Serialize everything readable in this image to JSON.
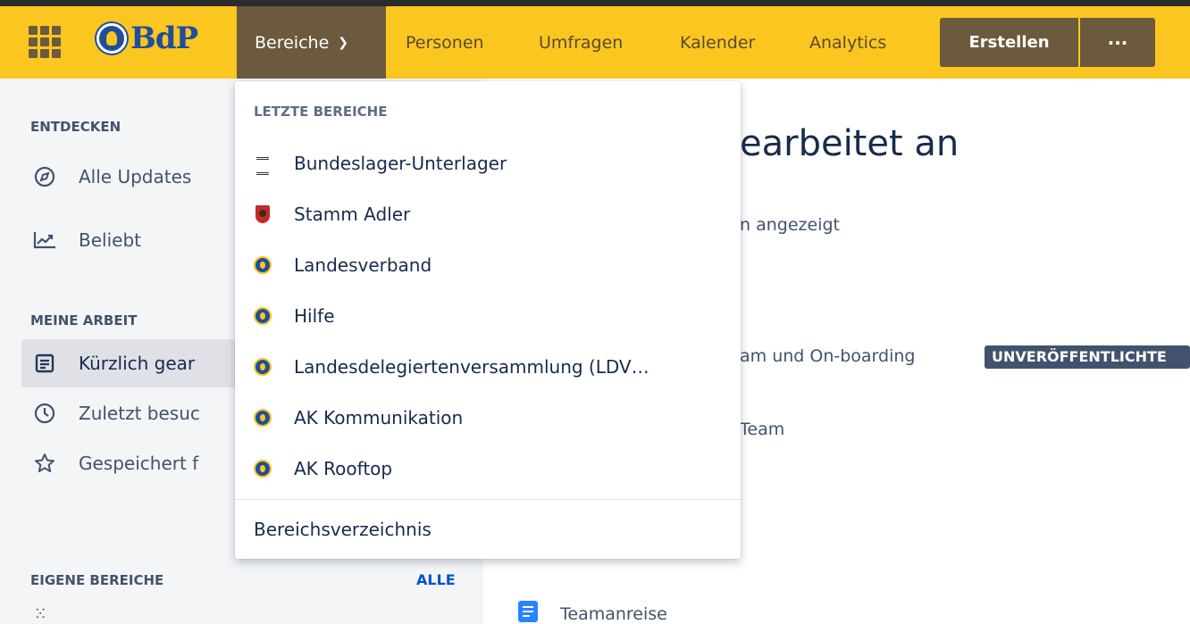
{
  "header": {
    "logo_text": "BdP",
    "nav_active": "Bereiche",
    "nav": [
      "Personen",
      "Umfragen",
      "Kalender",
      "Analytics"
    ],
    "create_label": "Erstellen",
    "more_label": "···"
  },
  "sidebar": {
    "discover_title": "ENTDECKEN",
    "discover_items": [
      "Alle Updates",
      "Beliebt"
    ],
    "mywork_title": "MEINE ARBEIT",
    "mywork_items": [
      "Kürzlich gear",
      "Zuletzt besuc",
      "Gespeichert f"
    ],
    "own_spaces_title": "EIGENE BEREICHE",
    "own_spaces_all": "ALLE"
  },
  "main": {
    "title": "earbeitet an",
    "subtitle": "n angezeigt",
    "item1": "am und On-boarding",
    "badge": "UNVERÖFFENTLICHTE",
    "item2": "Team",
    "item3": "Teamanreise"
  },
  "dropdown": {
    "heading": "LETZTE BEREICHE",
    "items": [
      {
        "label": "Bundeslager-Unterlager",
        "icon": "camp-icon"
      },
      {
        "label": "Stamm Adler",
        "icon": "shield-icon"
      },
      {
        "label": "Landesverband",
        "icon": "scout-logo-icon"
      },
      {
        "label": "Hilfe",
        "icon": "scout-logo-icon"
      },
      {
        "label": "Landesdelegiertenversammlung (LDV…",
        "icon": "scout-logo-icon"
      },
      {
        "label": "AK Kommunikation",
        "icon": "scout-logo-icon"
      },
      {
        "label": "AK Rooftop",
        "icon": "scout-logo-icon"
      }
    ],
    "footer": "Bereichsverzeichnis"
  },
  "colors": {
    "topbar": "#fcc620",
    "nav_dark": "#6b5a3e",
    "brand_blue": "#1f4e9c",
    "link": "#0052cc"
  }
}
